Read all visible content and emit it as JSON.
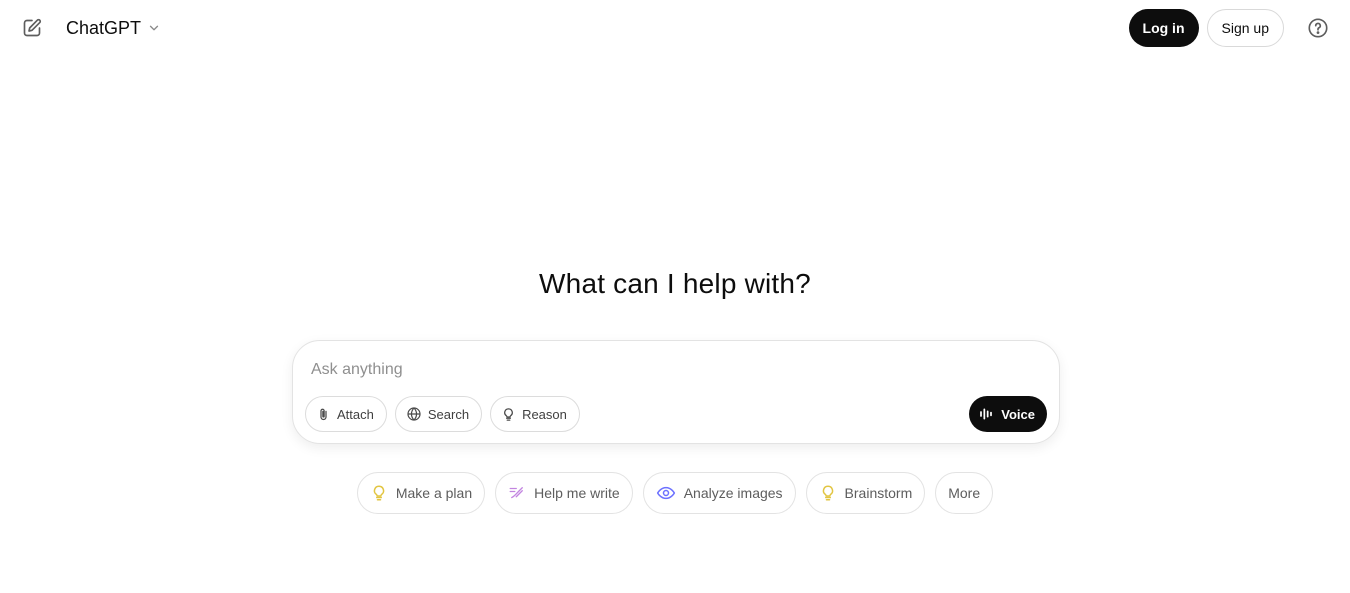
{
  "header": {
    "model_name": "ChatGPT",
    "login_label": "Log in",
    "signup_label": "Sign up",
    "icons": [
      "new-chat-icon",
      "chevron-down-icon",
      "help-icon"
    ]
  },
  "main": {
    "headline": "What can I help with?",
    "composer": {
      "placeholder": "Ask anything",
      "value": "",
      "tools": [
        {
          "label": "Attach",
          "icon": "paperclip-icon"
        },
        {
          "label": "Search",
          "icon": "globe-icon"
        },
        {
          "label": "Reason",
          "icon": "lightbulb-icon"
        }
      ],
      "voice_label": "Voice",
      "voice_icon": "waveform-icon"
    },
    "suggestions": [
      {
        "label": "Make a plan",
        "icon": "lightbulb-icon",
        "color": "#e2c541"
      },
      {
        "label": "Help me write",
        "icon": "pen-icon",
        "color": "#c285e0"
      },
      {
        "label": "Analyze images",
        "icon": "eye-icon",
        "color": "#6c71ff"
      },
      {
        "label": "Brainstorm",
        "icon": "lightbulb-icon",
        "color": "#e2c541"
      },
      {
        "label": "More",
        "icon": "",
        "color": ""
      }
    ]
  },
  "colors": {
    "primary_button": "#0d0d0d",
    "border": "#e3e3e3",
    "text_muted": "#5d5d5d"
  }
}
